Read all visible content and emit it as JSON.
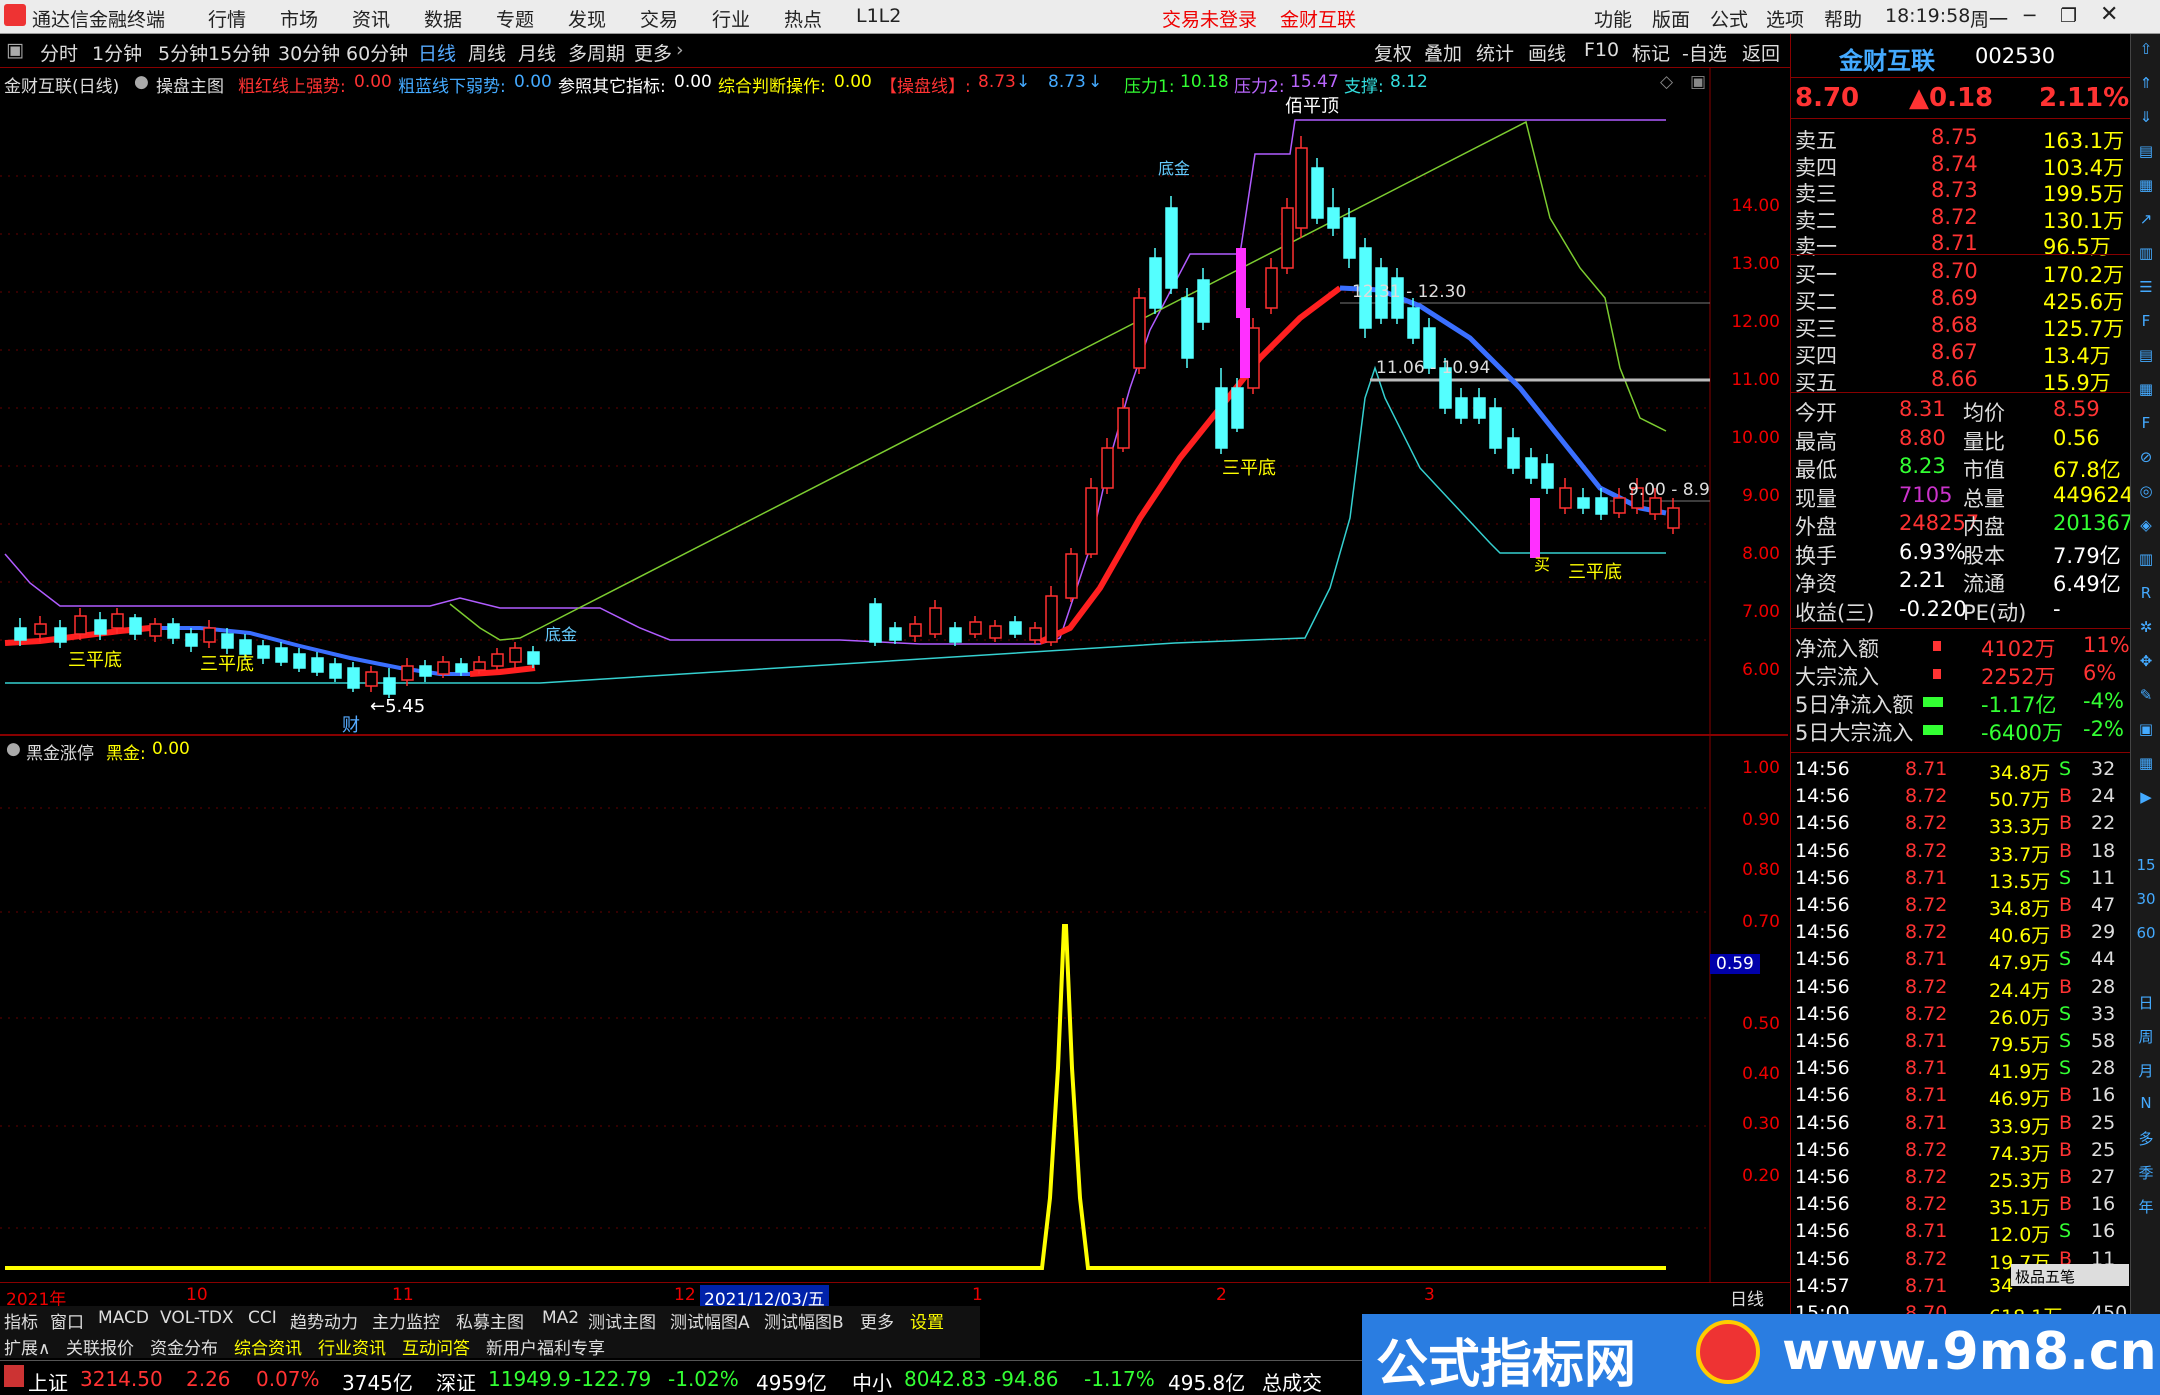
{
  "titlebar": {
    "app_title": "通达信金融终端",
    "menu": [
      "行情",
      "市场",
      "资讯",
      "数据",
      "专题",
      "发现",
      "交易",
      "行业",
      "热点",
      "L1L2"
    ],
    "login_status": "交易未登录",
    "stock_tab": "金财互联",
    "right_menu": [
      "功能",
      "版面",
      "公式",
      "选项",
      "帮助"
    ],
    "time": "18:19:58",
    "weekday": "周一"
  },
  "periodbar": {
    "items": [
      "分时",
      "1分钟",
      "5分钟",
      "15分钟",
      "30分钟",
      "60分钟",
      "日线",
      "周线",
      "月线",
      "多周期",
      "更多"
    ],
    "active": "日线",
    "tools": [
      "复权",
      "叠加",
      "统计",
      "画线",
      "F10",
      "标记",
      "-自选",
      "返回"
    ]
  },
  "indicator_main": {
    "stock": "金财互联(日线)",
    "formula": "操盘主图",
    "p1_label": "粗红线上强势:",
    "p1_value": "0.00",
    "p2_label": "粗蓝线下弱势:",
    "p2_value": "0.00",
    "p3_label": "参照其它指标:",
    "p3_value": "0.00",
    "p4_label": "综合判断操作:",
    "p4_value": "0.00",
    "p5_label": "【操盘线】:",
    "p5_value": "8.73",
    "p6_value": "8.73",
    "pressure1_label": "压力1:",
    "pressure1_value": "10.18",
    "pressure2_label": "压力2:",
    "pressure2_value": "15.47",
    "support_label": "支撑:",
    "support_value": "8.12"
  },
  "indicator_sub": {
    "name": "黑金涨停",
    "label": "黑金:",
    "value": "0.00"
  },
  "main_axis": [
    "14.00",
    "13.00",
    "12.00",
    "11.00",
    "10.00",
    "9.00",
    "8.00",
    "7.00",
    "6.00"
  ],
  "sub_axis": [
    "1.00",
    "0.90",
    "0.80",
    "0.70",
    "0.59",
    "0.50",
    "0.40",
    "0.30",
    "0.20"
  ],
  "chart_annotations": {
    "top": "佰平顶",
    "low": "←5.45",
    "cai": "财",
    "sanpingdi": "三平底",
    "dixi": "底金",
    "mai": "买",
    "range1": "12.31 - 12.30",
    "range2": "11.06 - 10.94",
    "range3": "9.00 - 8.9"
  },
  "date_axis": {
    "labels": [
      "2021年",
      "10",
      "11",
      "12",
      "1",
      "2",
      "3"
    ],
    "cursor_date": "2021/12/03/五",
    "period": "日线"
  },
  "bottom_tabs": [
    "指标",
    "窗口",
    "MACD",
    "VOL-TDX",
    "CCI",
    "趋势动力",
    "主力监控",
    "私募主图",
    "MA2",
    "测试主图",
    "测试幅图A",
    "测试幅图B",
    "更多",
    "设置"
  ],
  "bottom_tabs2": [
    "扩展∧",
    "关联报价",
    "资金分布",
    "综合资讯",
    "行业资讯",
    "互动问答",
    "新用户福利专享"
  ],
  "status": {
    "sh_label": "上证",
    "sh_value": "3214.50",
    "sh_change": "2.26",
    "sh_pct": "0.07%",
    "sh_amount": "3745亿",
    "sz_label": "深证",
    "sz_value": "11949.9",
    "sz_change": "-122.79",
    "sz_pct": "-1.02%",
    "sz_amount": "4959亿",
    "zx_label": "中小",
    "zx_value": "8042.83",
    "zx_change": "-94.86",
    "zx_pct": "-1.17%",
    "zx_amount": "495.8亿",
    "total_label": "总成交"
  },
  "quote": {
    "name": "金财互联",
    "code": "002530",
    "price": "8.70",
    "change": "▲0.18",
    "pct": "2.11%",
    "asks": [
      {
        "label": "卖五",
        "price": "8.75",
        "vol": "163.1万"
      },
      {
        "label": "卖四",
        "price": "8.74",
        "vol": "103.4万"
      },
      {
        "label": "卖三",
        "price": "8.73",
        "vol": "199.5万"
      },
      {
        "label": "卖二",
        "price": "8.72",
        "vol": "130.1万"
      },
      {
        "label": "卖一",
        "price": "8.71",
        "vol": "96.5万"
      }
    ],
    "bids": [
      {
        "label": "买一",
        "price": "8.70",
        "vol": "170.2万"
      },
      {
        "label": "买二",
        "price": "8.69",
        "vol": "425.6万"
      },
      {
        "label": "买三",
        "price": "8.68",
        "vol": "125.7万"
      },
      {
        "label": "买四",
        "price": "8.67",
        "vol": "13.4万"
      },
      {
        "label": "买五",
        "price": "8.66",
        "vol": "15.9万"
      }
    ],
    "stats": [
      {
        "l1": "今开",
        "v1": "8.31",
        "l2": "均价",
        "v2": "8.59"
      },
      {
        "l1": "最高",
        "v1": "8.80",
        "l2": "量比",
        "v2": "0.56"
      },
      {
        "l1": "最低",
        "v1": "8.23",
        "l2": "市值",
        "v2": "67.8亿"
      },
      {
        "l1": "现量",
        "v1": "7105",
        "l2": "总量",
        "v2": "449624"
      },
      {
        "l1": "外盘",
        "v1": "248257",
        "l2": "内盘",
        "v2": "201367"
      },
      {
        "l1": "换手",
        "v1": "6.93%",
        "l2": "股本",
        "v2": "7.79亿"
      },
      {
        "l1": "净资",
        "v1": "2.21",
        "l2": "流通",
        "v2": "6.49亿"
      },
      {
        "l1": "收益(三)",
        "v1": "-0.220",
        "l2": "PE(动)",
        "v2": "-"
      }
    ],
    "flows": [
      {
        "label": "净流入额",
        "value": "4102万",
        "pct": "11%"
      },
      {
        "label": "大宗流入",
        "value": "2252万",
        "pct": "6%"
      },
      {
        "label": "5日净流入额",
        "value": "-1.17亿",
        "pct": "-4%"
      },
      {
        "label": "5日大宗流入",
        "value": "-6400万",
        "pct": "-2%"
      }
    ],
    "ticks": [
      {
        "t": "14:56",
        "p": "8.71",
        "v": "34.8万",
        "s": "S",
        "n": "32"
      },
      {
        "t": "14:56",
        "p": "8.72",
        "v": "50.7万",
        "s": "B",
        "n": "24"
      },
      {
        "t": "14:56",
        "p": "8.72",
        "v": "33.3万",
        "s": "B",
        "n": "22"
      },
      {
        "t": "14:56",
        "p": "8.72",
        "v": "33.7万",
        "s": "B",
        "n": "18"
      },
      {
        "t": "14:56",
        "p": "8.71",
        "v": "13.5万",
        "s": "S",
        "n": "11"
      },
      {
        "t": "14:56",
        "p": "8.72",
        "v": "34.8万",
        "s": "B",
        "n": "47"
      },
      {
        "t": "14:56",
        "p": "8.72",
        "v": "40.6万",
        "s": "B",
        "n": "29"
      },
      {
        "t": "14:56",
        "p": "8.71",
        "v": "47.9万",
        "s": "S",
        "n": "44"
      },
      {
        "t": "14:56",
        "p": "8.72",
        "v": "24.4万",
        "s": "B",
        "n": "28"
      },
      {
        "t": "14:56",
        "p": "8.72",
        "v": "26.0万",
        "s": "S",
        "n": "33"
      },
      {
        "t": "14:56",
        "p": "8.71",
        "v": "79.5万",
        "s": "S",
        "n": "58"
      },
      {
        "t": "14:56",
        "p": "8.71",
        "v": "41.9万",
        "s": "S",
        "n": "28"
      },
      {
        "t": "14:56",
        "p": "8.71",
        "v": "46.9万",
        "s": "B",
        "n": "16"
      },
      {
        "t": "14:56",
        "p": "8.71",
        "v": "33.9万",
        "s": "B",
        "n": "25"
      },
      {
        "t": "14:56",
        "p": "8.72",
        "v": "74.3万",
        "s": "B",
        "n": "25"
      },
      {
        "t": "14:56",
        "p": "8.72",
        "v": "25.3万",
        "s": "B",
        "n": "27"
      },
      {
        "t": "14:56",
        "p": "8.72",
        "v": "35.1万",
        "s": "B",
        "n": "16"
      },
      {
        "t": "14:56",
        "p": "8.71",
        "v": "12.0万",
        "s": "S",
        "n": "16"
      },
      {
        "t": "14:56",
        "p": "8.72",
        "v": "19.7万",
        "s": "B",
        "n": "11"
      },
      {
        "t": "14:57",
        "p": "8.71",
        "v": "34",
        "s": "",
        "n": ""
      },
      {
        "t": "15:00",
        "p": "8.70",
        "v": "618.1万",
        "s": "",
        "n": "450"
      }
    ],
    "mini_panel": "极品五笔"
  },
  "sidebar": [
    "15",
    "30",
    "60",
    "日",
    "周",
    "月",
    "N",
    "多",
    "季",
    "年"
  ],
  "watermark": {
    "text1": "公式指标网",
    "text2": "www.9m8.cn"
  },
  "colors": {
    "up": "#ff3333",
    "down": "#54ffff",
    "yellow": "#ffff00",
    "blue": "#3a6fff"
  }
}
